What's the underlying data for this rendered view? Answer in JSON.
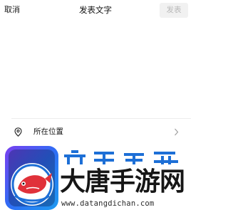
{
  "nav": {
    "cancel_label": "取消",
    "title": "发表文字",
    "publish_label": "发表"
  },
  "compose": {
    "value": "",
    "placeholder": ""
  },
  "location": {
    "label": "所在位置",
    "icon": "location-pin-icon",
    "chevron": "chevron-right-icon"
  },
  "watermark": {
    "brand_text": "大唐手游网",
    "url_text": "www.datangdichan.com"
  },
  "colors": {
    "publish_bg": "#f1f1f1",
    "publish_text": "#b8b8b8",
    "watermark_blue": "#1d6fd6",
    "watermark_red": "#e0313a"
  }
}
